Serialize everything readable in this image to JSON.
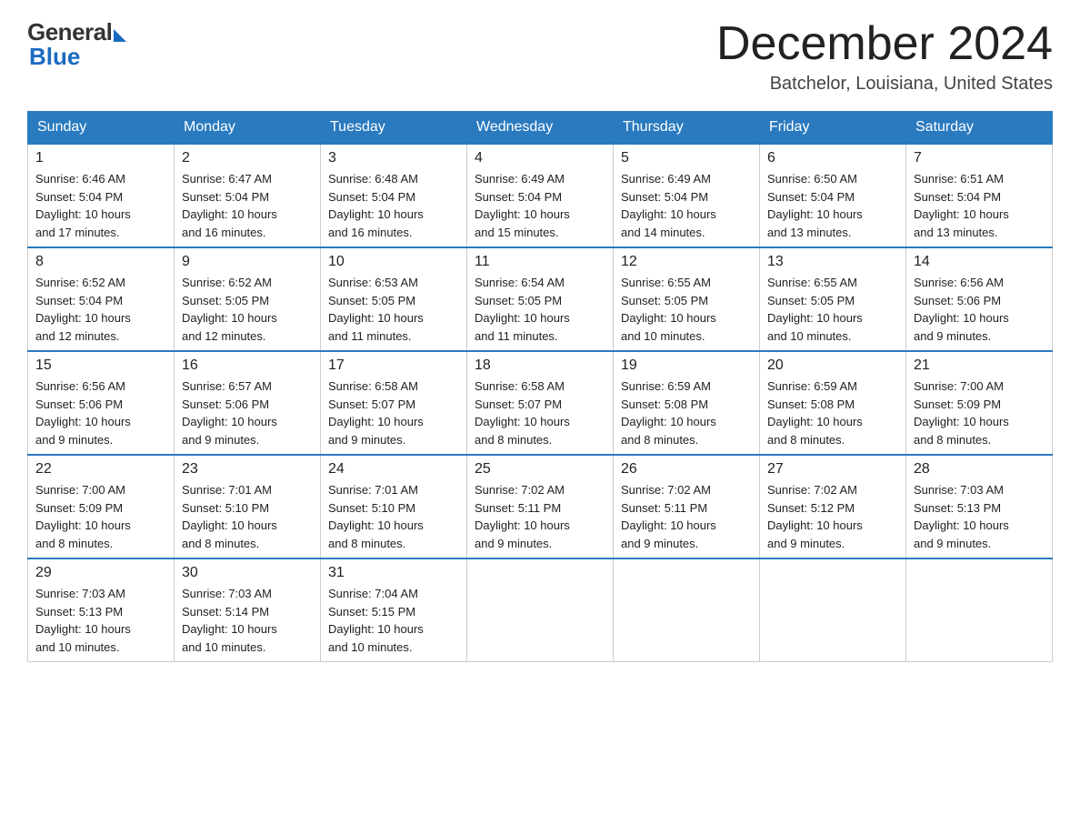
{
  "header": {
    "logo_general": "General",
    "logo_blue": "Blue",
    "month_title": "December 2024",
    "location": "Batchelor, Louisiana, United States"
  },
  "days_of_week": [
    "Sunday",
    "Monday",
    "Tuesday",
    "Wednesday",
    "Thursday",
    "Friday",
    "Saturday"
  ],
  "weeks": [
    [
      {
        "day": "1",
        "sunrise": "6:46 AM",
        "sunset": "5:04 PM",
        "daylight": "10 hours and 17 minutes."
      },
      {
        "day": "2",
        "sunrise": "6:47 AM",
        "sunset": "5:04 PM",
        "daylight": "10 hours and 16 minutes."
      },
      {
        "day": "3",
        "sunrise": "6:48 AM",
        "sunset": "5:04 PM",
        "daylight": "10 hours and 16 minutes."
      },
      {
        "day": "4",
        "sunrise": "6:49 AM",
        "sunset": "5:04 PM",
        "daylight": "10 hours and 15 minutes."
      },
      {
        "day": "5",
        "sunrise": "6:49 AM",
        "sunset": "5:04 PM",
        "daylight": "10 hours and 14 minutes."
      },
      {
        "day": "6",
        "sunrise": "6:50 AM",
        "sunset": "5:04 PM",
        "daylight": "10 hours and 13 minutes."
      },
      {
        "day": "7",
        "sunrise": "6:51 AM",
        "sunset": "5:04 PM",
        "daylight": "10 hours and 13 minutes."
      }
    ],
    [
      {
        "day": "8",
        "sunrise": "6:52 AM",
        "sunset": "5:04 PM",
        "daylight": "10 hours and 12 minutes."
      },
      {
        "day": "9",
        "sunrise": "6:52 AM",
        "sunset": "5:05 PM",
        "daylight": "10 hours and 12 minutes."
      },
      {
        "day": "10",
        "sunrise": "6:53 AM",
        "sunset": "5:05 PM",
        "daylight": "10 hours and 11 minutes."
      },
      {
        "day": "11",
        "sunrise": "6:54 AM",
        "sunset": "5:05 PM",
        "daylight": "10 hours and 11 minutes."
      },
      {
        "day": "12",
        "sunrise": "6:55 AM",
        "sunset": "5:05 PM",
        "daylight": "10 hours and 10 minutes."
      },
      {
        "day": "13",
        "sunrise": "6:55 AM",
        "sunset": "5:05 PM",
        "daylight": "10 hours and 10 minutes."
      },
      {
        "day": "14",
        "sunrise": "6:56 AM",
        "sunset": "5:06 PM",
        "daylight": "10 hours and 9 minutes."
      }
    ],
    [
      {
        "day": "15",
        "sunrise": "6:56 AM",
        "sunset": "5:06 PM",
        "daylight": "10 hours and 9 minutes."
      },
      {
        "day": "16",
        "sunrise": "6:57 AM",
        "sunset": "5:06 PM",
        "daylight": "10 hours and 9 minutes."
      },
      {
        "day": "17",
        "sunrise": "6:58 AM",
        "sunset": "5:07 PM",
        "daylight": "10 hours and 9 minutes."
      },
      {
        "day": "18",
        "sunrise": "6:58 AM",
        "sunset": "5:07 PM",
        "daylight": "10 hours and 8 minutes."
      },
      {
        "day": "19",
        "sunrise": "6:59 AM",
        "sunset": "5:08 PM",
        "daylight": "10 hours and 8 minutes."
      },
      {
        "day": "20",
        "sunrise": "6:59 AM",
        "sunset": "5:08 PM",
        "daylight": "10 hours and 8 minutes."
      },
      {
        "day": "21",
        "sunrise": "7:00 AM",
        "sunset": "5:09 PM",
        "daylight": "10 hours and 8 minutes."
      }
    ],
    [
      {
        "day": "22",
        "sunrise": "7:00 AM",
        "sunset": "5:09 PM",
        "daylight": "10 hours and 8 minutes."
      },
      {
        "day": "23",
        "sunrise": "7:01 AM",
        "sunset": "5:10 PM",
        "daylight": "10 hours and 8 minutes."
      },
      {
        "day": "24",
        "sunrise": "7:01 AM",
        "sunset": "5:10 PM",
        "daylight": "10 hours and 8 minutes."
      },
      {
        "day": "25",
        "sunrise": "7:02 AM",
        "sunset": "5:11 PM",
        "daylight": "10 hours and 9 minutes."
      },
      {
        "day": "26",
        "sunrise": "7:02 AM",
        "sunset": "5:11 PM",
        "daylight": "10 hours and 9 minutes."
      },
      {
        "day": "27",
        "sunrise": "7:02 AM",
        "sunset": "5:12 PM",
        "daylight": "10 hours and 9 minutes."
      },
      {
        "day": "28",
        "sunrise": "7:03 AM",
        "sunset": "5:13 PM",
        "daylight": "10 hours and 9 minutes."
      }
    ],
    [
      {
        "day": "29",
        "sunrise": "7:03 AM",
        "sunset": "5:13 PM",
        "daylight": "10 hours and 10 minutes."
      },
      {
        "day": "30",
        "sunrise": "7:03 AM",
        "sunset": "5:14 PM",
        "daylight": "10 hours and 10 minutes."
      },
      {
        "day": "31",
        "sunrise": "7:04 AM",
        "sunset": "5:15 PM",
        "daylight": "10 hours and 10 minutes."
      },
      null,
      null,
      null,
      null
    ]
  ],
  "labels": {
    "sunrise": "Sunrise:",
    "sunset": "Sunset:",
    "daylight": "Daylight:"
  }
}
